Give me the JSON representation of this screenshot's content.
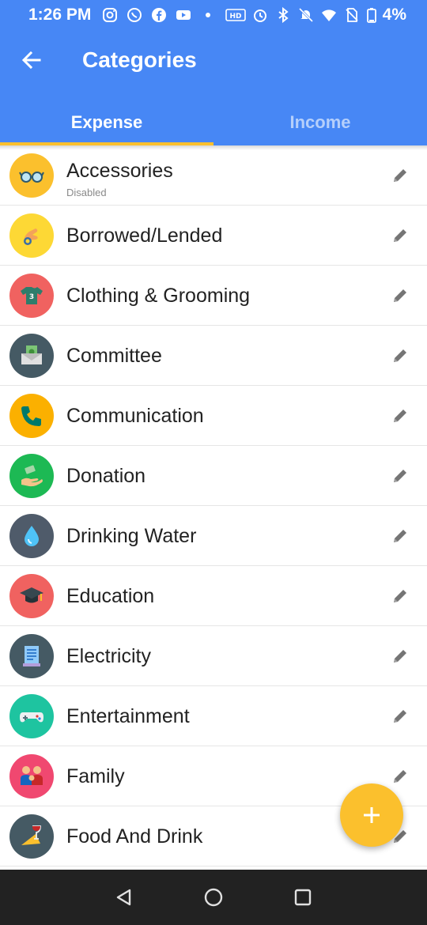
{
  "status_bar": {
    "time": "1:26 PM",
    "battery": "4%",
    "icons_left": [
      "instagram-icon",
      "whatsapp-icon",
      "facebook-icon",
      "youtube-icon",
      "dot-icon"
    ],
    "icons_right": [
      "hd-icon",
      "alarm-icon",
      "bluetooth-icon",
      "mute-icon",
      "wifi-icon",
      "no-sim-icon",
      "battery-icon"
    ]
  },
  "header": {
    "title": "Categories",
    "back_icon": "arrow-left-icon",
    "tabs": [
      {
        "label": "Expense",
        "active": true
      },
      {
        "label": "Income",
        "active": false
      }
    ]
  },
  "categories": [
    {
      "name": "Accessories",
      "subtitle": "Disabled",
      "icon": "glasses-icon",
      "color": "#fbc02d"
    },
    {
      "name": "Borrowed/Lended",
      "subtitle": "",
      "icon": "hand-coin-icon",
      "color": "#fdd835"
    },
    {
      "name": "Clothing & Grooming",
      "subtitle": "",
      "icon": "shirt-icon",
      "color": "#f06260"
    },
    {
      "name": "Committee",
      "subtitle": "",
      "icon": "money-envelope-icon",
      "color": "#455a64"
    },
    {
      "name": "Communication",
      "subtitle": "",
      "icon": "phone-icon",
      "color": "#fbb000"
    },
    {
      "name": "Donation",
      "subtitle": "",
      "icon": "donation-icon",
      "color": "#1db954"
    },
    {
      "name": "Drinking Water",
      "subtitle": "",
      "icon": "water-drop-icon",
      "color": "#4f5b6a"
    },
    {
      "name": "Education",
      "subtitle": "",
      "icon": "graduation-cap-icon",
      "color": "#f06260"
    },
    {
      "name": "Electricity",
      "subtitle": "",
      "icon": "bill-icon",
      "color": "#455a64"
    },
    {
      "name": "Entertainment",
      "subtitle": "",
      "icon": "gamepad-icon",
      "color": "#1ec4a0"
    },
    {
      "name": "Family",
      "subtitle": "",
      "icon": "family-icon",
      "color": "#f04870"
    },
    {
      "name": "Food And Drink",
      "subtitle": "",
      "icon": "food-drink-icon",
      "color": "#455a64"
    }
  ],
  "edit_icon": "pencil-icon",
  "fab": {
    "icon": "plus-icon",
    "color": "#fbc02d"
  },
  "nav_bar": {
    "icons": [
      "back-triangle-icon",
      "home-circle-icon",
      "recents-square-icon"
    ]
  },
  "colors": {
    "primary": "#4787f5",
    "accent": "#fbc02d"
  }
}
